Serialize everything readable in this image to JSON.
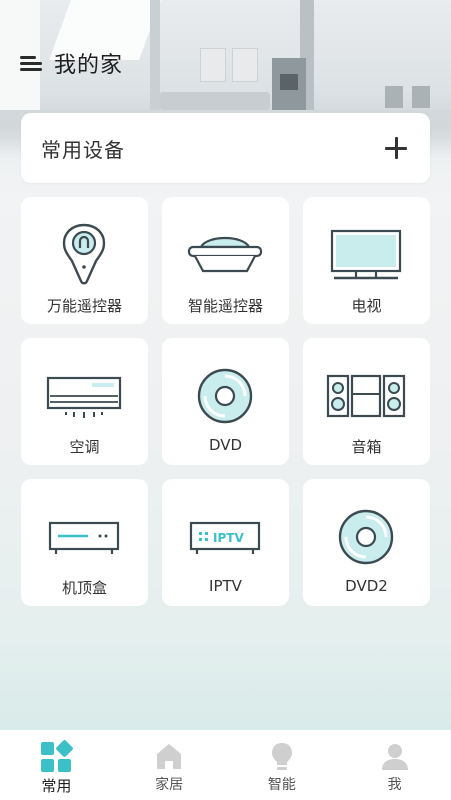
{
  "header": {
    "title": "我的家",
    "menu_icon": "menu-icon"
  },
  "common_devices": {
    "title": "常用设备",
    "add_icon": "plus-icon"
  },
  "devices": [
    {
      "label": "万能遥控器",
      "icon": "universal-remote-icon"
    },
    {
      "label": "智能遥控器",
      "icon": "smart-remote-icon"
    },
    {
      "label": "电视",
      "icon": "tv-icon"
    },
    {
      "label": "空调",
      "icon": "air-conditioner-icon"
    },
    {
      "label": "DVD",
      "icon": "dvd-disc-icon"
    },
    {
      "label": "音箱",
      "icon": "speaker-icon"
    },
    {
      "label": "机顶盒",
      "icon": "set-top-box-icon"
    },
    {
      "label": "IPTV",
      "icon": "iptv-icon"
    },
    {
      "label": "DVD2",
      "icon": "dvd-disc-icon"
    }
  ],
  "iptv_icon_text": "IPTV",
  "tabs": [
    {
      "label": "常用",
      "icon": "grid-apps-icon",
      "active": true
    },
    {
      "label": "家居",
      "icon": "home-icon",
      "active": false
    },
    {
      "label": "智能",
      "icon": "lightbulb-icon",
      "active": false
    },
    {
      "label": "我",
      "icon": "user-icon",
      "active": false
    }
  ],
  "colors": {
    "accent": "#3cc0c8",
    "icon_stroke": "#3c4a52",
    "icon_fill": "#c9ecec",
    "tab_inactive": "#cfcfcf"
  }
}
